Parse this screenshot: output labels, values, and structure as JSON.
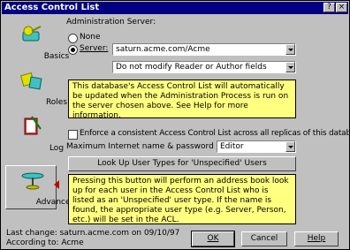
{
  "window": {
    "title": "Access Control List",
    "help_glyph": "?",
    "close_glyph": "×"
  },
  "sidebar": {
    "items": [
      {
        "label": "Basics",
        "icon": "key-icon"
      },
      {
        "label": "Roles",
        "icon": "roles-icon"
      },
      {
        "label": "Log",
        "icon": "log-book-icon"
      },
      {
        "label": "Advanced",
        "icon": "advanced-icon",
        "active": true
      }
    ]
  },
  "admin": {
    "heading": "Administration Server:",
    "none_label": "None",
    "server_label": "Server:",
    "selected": "Server",
    "server_value": "saturn.acme.com/Acme",
    "modify_value": "Do not modify Reader or Author fields"
  },
  "note1": {
    "text": "This database's Access Control List will automatically be updated when the Administration Process is run on the server chosen above. See Help for more information."
  },
  "enforce": {
    "label": "Enforce a consistent Access Control List across all replicas of this database",
    "checked": false
  },
  "max_access": {
    "label": "Maximum Internet name & password access:",
    "value": "Editor"
  },
  "lookup_button": {
    "label": "Look Up User Types for 'Unspecified' Users"
  },
  "note2": {
    "text": "Pressing this button will perform an address book look up for each user in the Access Control List who is listed as an 'Unspecified' user type. If the name is found, the appropriate user type (e.g. Server, Person, etc.) will be set in the ACL."
  },
  "footer": {
    "last_change": "Last change: saturn.acme.com on 09/10/97",
    "according_to": "According to: Acme",
    "ok_label": "OK",
    "cancel_label": "Cancel",
    "help_label": "Help"
  },
  "colors": {
    "titlebar": "#000080",
    "note_bg": "#ffff80",
    "arrow": "#c00000"
  }
}
